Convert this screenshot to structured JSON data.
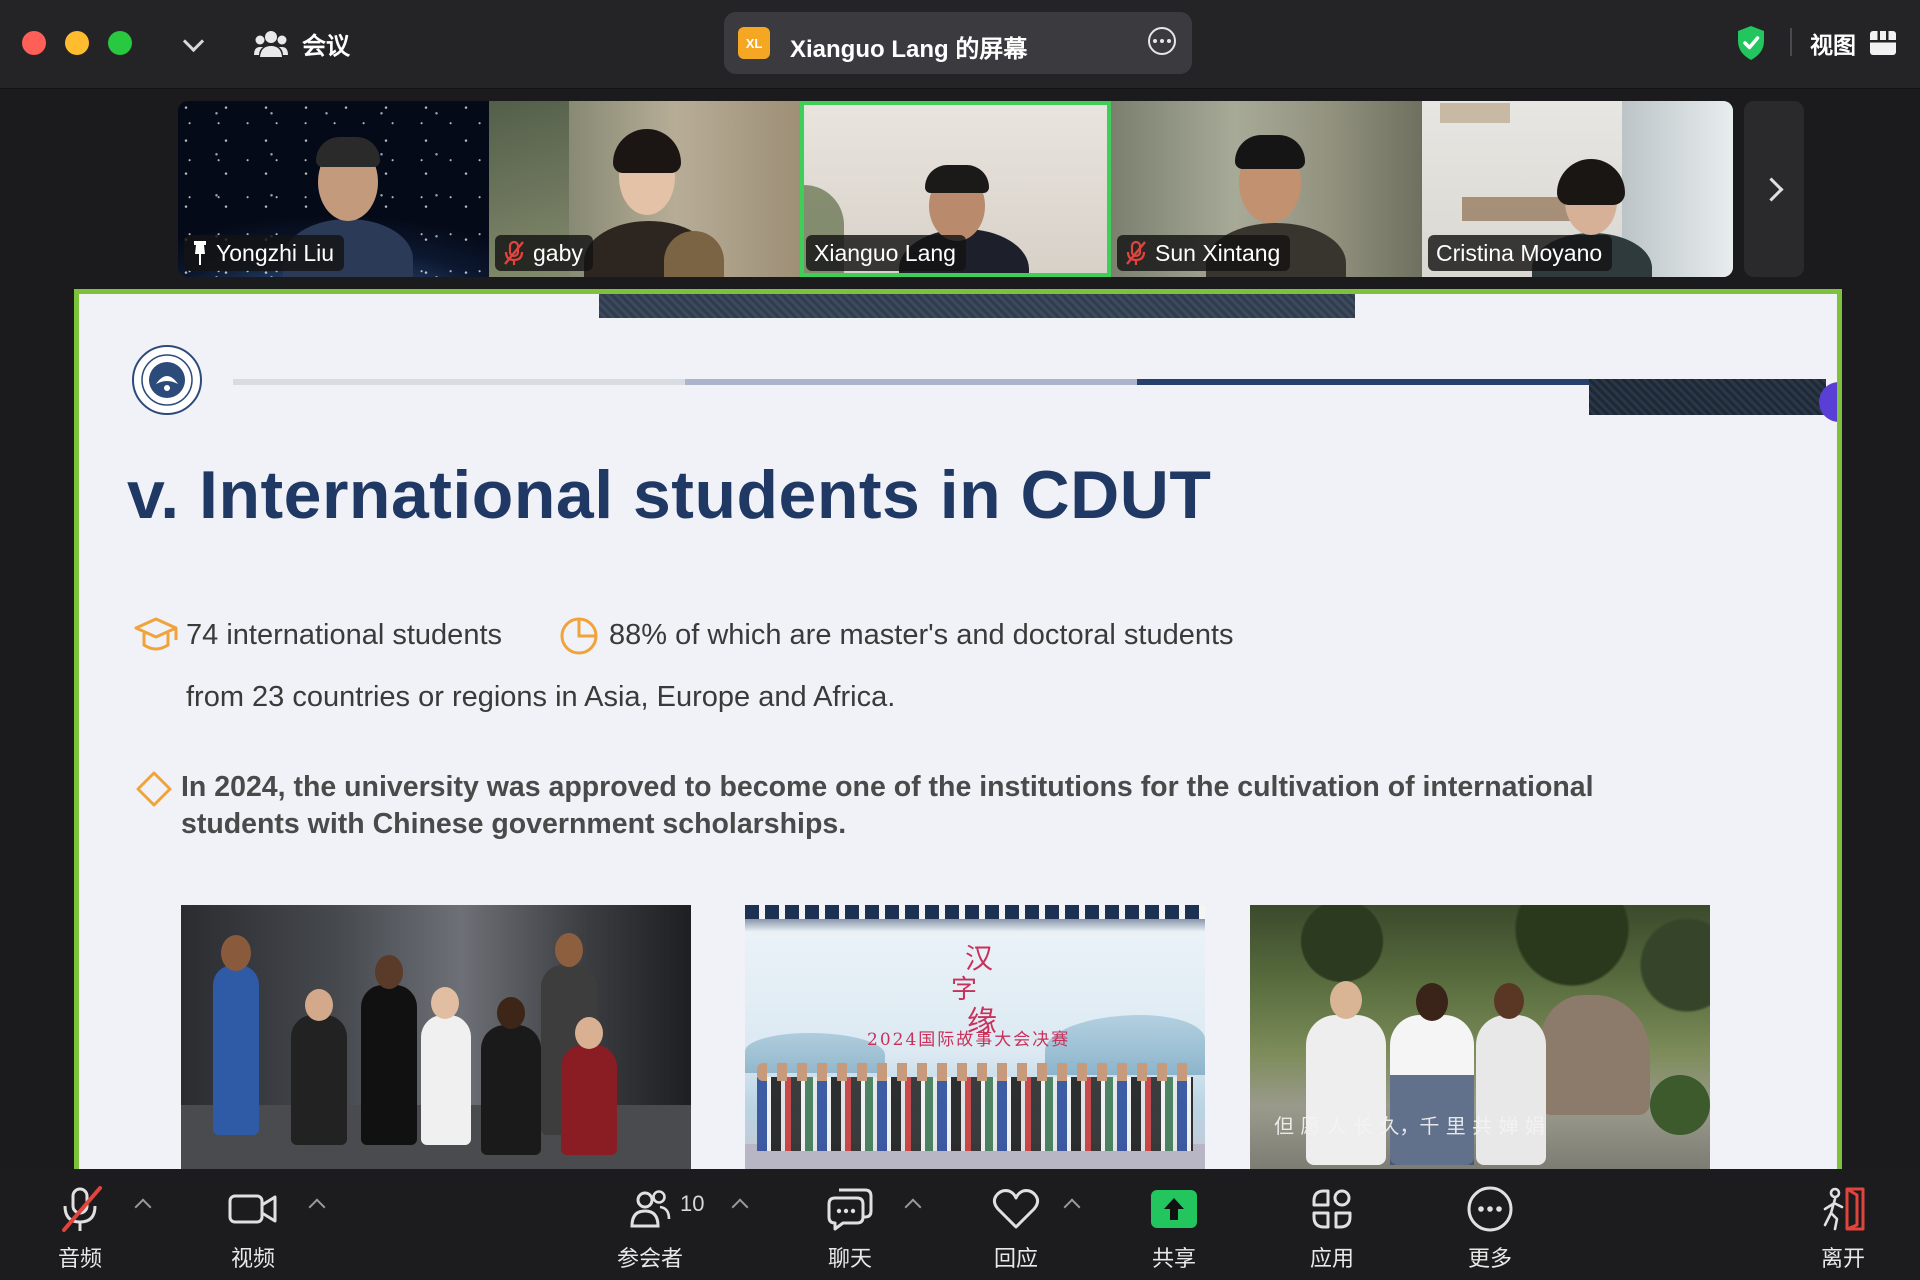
{
  "titlebar": {
    "meeting_label": "会议",
    "share_badge": "XL",
    "share_title": "Xianguo Lang 的屏幕",
    "view_label": "视图"
  },
  "gallery": [
    {
      "name": "Yongzhi Liu",
      "pinned": true,
      "muted": false,
      "active": false
    },
    {
      "name": "gaby",
      "pinned": false,
      "muted": true,
      "active": false
    },
    {
      "name": "Xianguo Lang",
      "pinned": false,
      "muted": false,
      "active": true
    },
    {
      "name": "Sun Xintang",
      "pinned": false,
      "muted": true,
      "active": false
    },
    {
      "name": "Cristina Moyano",
      "pinned": false,
      "muted": false,
      "active": false
    }
  ],
  "slide": {
    "title": "v. International students in CDUT",
    "stat1": "74 international students",
    "stat2": "88% of which are master's and doctoral students",
    "stat3": "from 23 countries or regions in Asia, Europe and Africa.",
    "highlight_line1": "In 2024, the university was approved to become one of the institutions for the cultivation of international",
    "highlight_line2": "students with Chinese government scholarships.",
    "poster_title": "2024国际故事大会决赛",
    "poster_char1": "汉",
    "poster_char2": "字",
    "poster_char3": "缘",
    "photo3_caption": "但 愿 人 长 久，千 里 共 婵 娟"
  },
  "toolbar": {
    "audio": "音频",
    "video": "视频",
    "participants": "参会者",
    "participants_count": "10",
    "chat": "聊天",
    "react": "回应",
    "share": "共享",
    "apps": "应用",
    "more": "更多",
    "leave": "离开"
  },
  "colors": {
    "accent_green": "#7ec13a",
    "slide_title": "#1f3864",
    "share_green": "#22c55e",
    "mute_red": "#e0443c"
  }
}
